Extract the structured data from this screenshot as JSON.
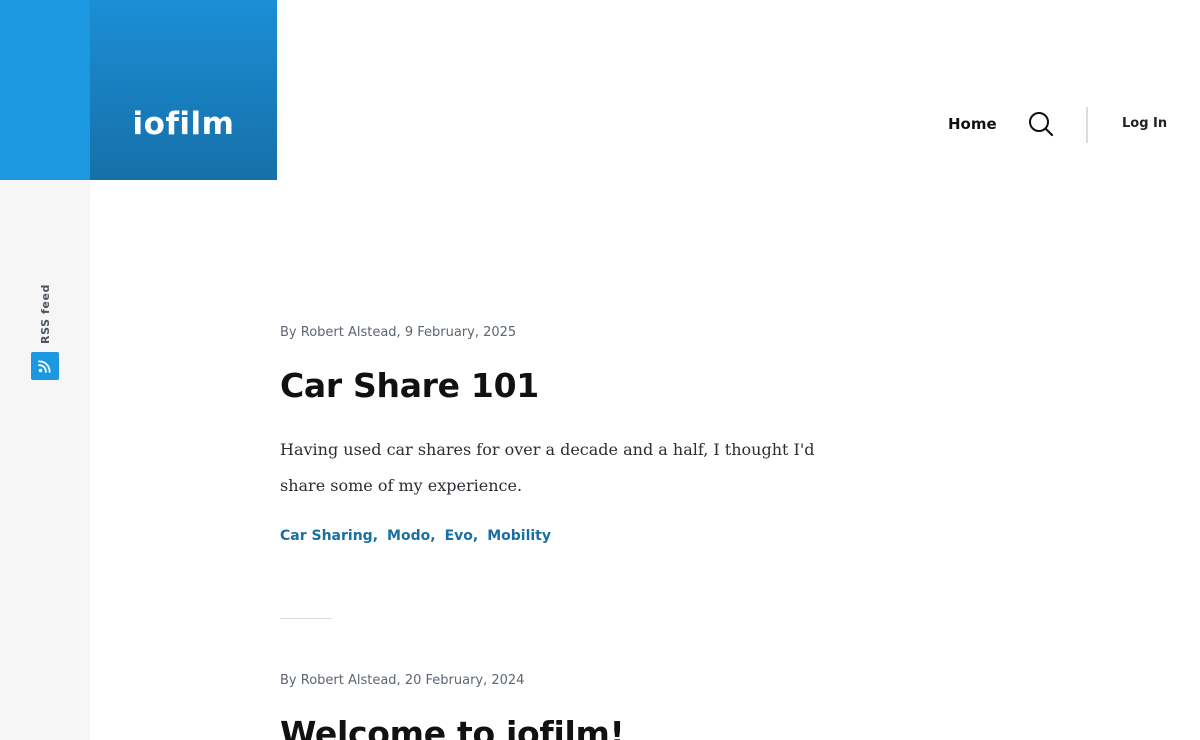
{
  "site": {
    "logo_text": "iofilm",
    "brand_color": "#1b98e0"
  },
  "sidebar": {
    "rss_label": "RSS feed",
    "rss_icon": "rss-feed-icon"
  },
  "nav": {
    "home_label": "Home",
    "search_icon": "search-icon",
    "login_label": "Log In"
  },
  "posts": [
    {
      "byline": "By Robert Alstead, 9 February, 2025",
      "title": "Car Share 101",
      "excerpt": "Having used car shares for over a decade and a half, I thought I'd share some of my experience.",
      "tags": [
        "Car Sharing",
        "Modo",
        "Evo",
        "Mobility"
      ]
    },
    {
      "byline": "By Robert Alstead, 20 February, 2024",
      "title": "Welcome to iofilm!"
    }
  ],
  "colors": {
    "tag_link": "#1a6fa3",
    "sidebar_bg": "#f5f6f5"
  }
}
